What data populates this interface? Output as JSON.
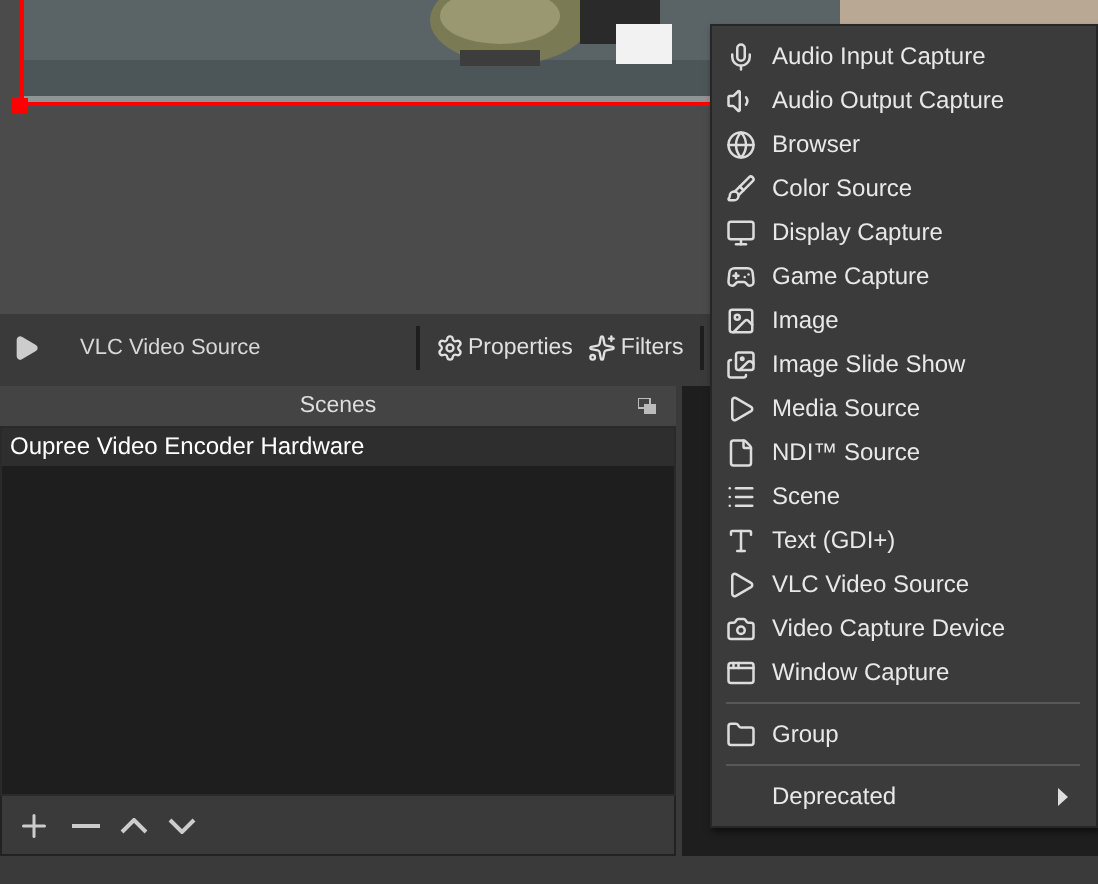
{
  "source_toolbar": {
    "source_name": "VLC Video Source",
    "buttons": [
      "Properties",
      "Filters"
    ]
  },
  "scenes": {
    "title": "Scenes",
    "items": [
      {
        "label": "Oupree Video Encoder Hardware",
        "selected": true
      }
    ]
  },
  "context_menu": {
    "items": [
      {
        "kind": "item",
        "label": "Audio Input Capture"
      },
      {
        "kind": "item",
        "label": "Audio Output Capture"
      },
      {
        "kind": "item",
        "label": "Browser"
      },
      {
        "kind": "item",
        "label": "Color Source"
      },
      {
        "kind": "item",
        "label": "Display Capture"
      },
      {
        "kind": "item",
        "label": "Game Capture"
      },
      {
        "kind": "item",
        "label": "Image"
      },
      {
        "kind": "item",
        "label": "Image Slide Show"
      },
      {
        "kind": "item",
        "label": "Media Source"
      },
      {
        "kind": "item",
        "label": "NDI™ Source"
      },
      {
        "kind": "item",
        "label": "Scene"
      },
      {
        "kind": "item",
        "label": "Text (GDI+)"
      },
      {
        "kind": "item",
        "label": "VLC Video Source"
      },
      {
        "kind": "item",
        "label": "Video Capture Device"
      },
      {
        "kind": "item",
        "label": "Window Capture"
      },
      {
        "kind": "separator"
      },
      {
        "kind": "item",
        "label": "Group"
      },
      {
        "kind": "separator"
      },
      {
        "kind": "submenu",
        "label": "Deprecated"
      }
    ]
  }
}
